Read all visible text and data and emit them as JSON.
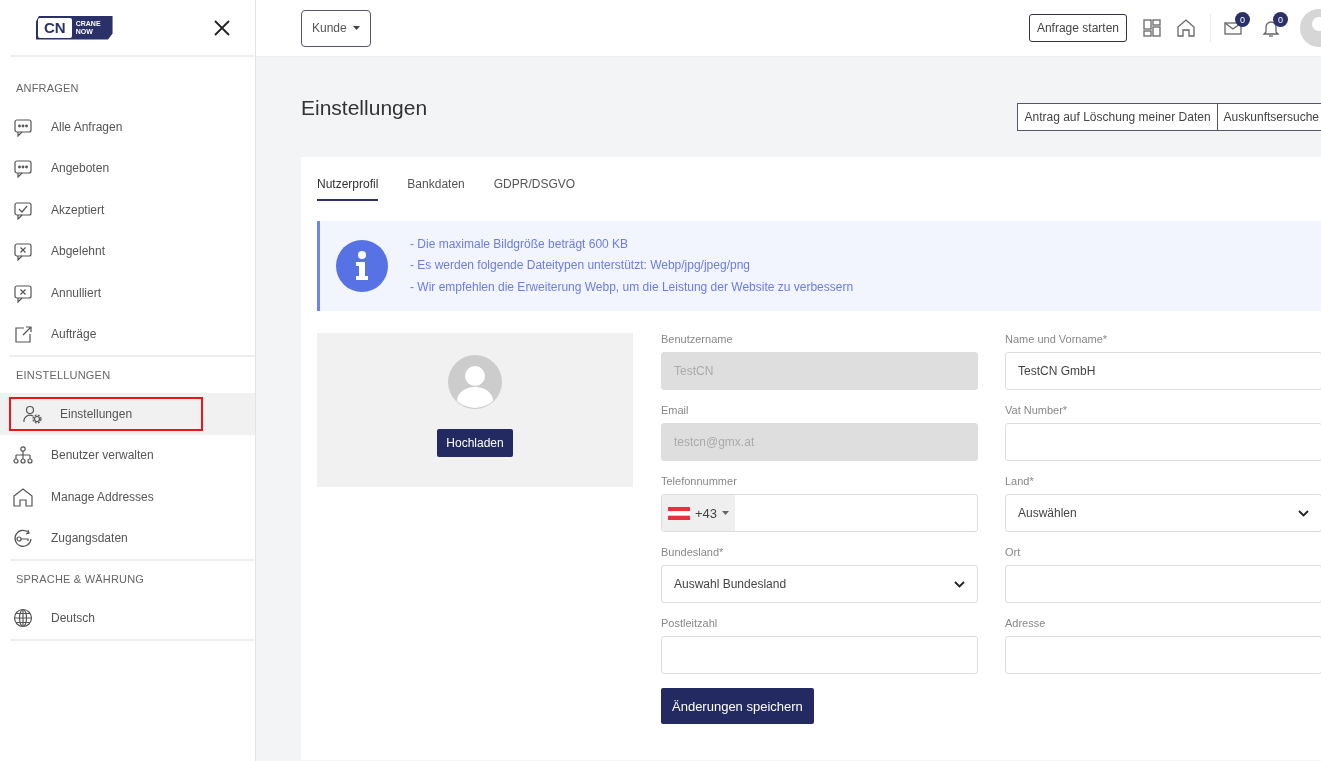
{
  "logo": {
    "mark": "CN",
    "word_top": "CRANE",
    "word_bottom": "NOW"
  },
  "sidebar": {
    "sections": [
      {
        "title": "ANFRAGEN",
        "items": [
          {
            "label": "Alle Anfragen",
            "selected": false,
            "highlighted": false
          },
          {
            "label": "Angeboten",
            "selected": false,
            "highlighted": false
          },
          {
            "label": "Akzeptiert",
            "selected": false,
            "highlighted": false
          },
          {
            "label": "Abgelehnt",
            "selected": false,
            "highlighted": false
          },
          {
            "label": "Annulliert",
            "selected": false,
            "highlighted": false
          },
          {
            "label": "Aufträge",
            "selected": false,
            "highlighted": false
          }
        ]
      },
      {
        "title": "EINSTELLUNGEN",
        "items": [
          {
            "label": "Einstellungen",
            "selected": true,
            "highlighted": true
          },
          {
            "label": "Benutzer verwalten",
            "selected": false,
            "highlighted": false
          },
          {
            "label": "Manage Addresses",
            "selected": false,
            "highlighted": false
          },
          {
            "label": "Zugangsdaten",
            "selected": false,
            "highlighted": false
          }
        ]
      },
      {
        "title": "SPRACHE & WÄHRUNG",
        "items": [
          {
            "label": "Deutsch",
            "selected": false,
            "highlighted": false
          }
        ]
      }
    ]
  },
  "topbar": {
    "role_dropdown": "Kunde",
    "start_button": "Anfrage starten",
    "messages_count": "0",
    "notifications_count": "0"
  },
  "page": {
    "title": "Einstellungen",
    "actions": [
      "Antrag auf Löschung meiner Daten",
      "Auskunftsersuche"
    ]
  },
  "tabs": [
    {
      "label": "Nutzerprofil",
      "selected": true
    },
    {
      "label": "Bankdaten",
      "selected": false
    },
    {
      "label": "GDPR/DSGVO",
      "selected": false
    }
  ],
  "info": [
    "- Die maximale Bildgröße beträgt 600 KB",
    "- Es werden folgende Dateitypen unterstützt: Webp/jpg/jpeg/png",
    "- Wir empfehlen die Erweiterung Webp, um die Leistung der Website zu verbessern"
  ],
  "avatar": {
    "upload_button": "Hochladen"
  },
  "fields": [
    {
      "label": "Benutzername",
      "kind": "text",
      "value": "TestCN",
      "disabled": true
    },
    {
      "label": "Name und Vorname*",
      "kind": "text",
      "value": "TestCN GmbH",
      "disabled": false
    },
    {
      "label": "Email",
      "kind": "text",
      "value": "testcn@gmx.at",
      "disabled": true
    },
    {
      "label": "Vat Number*",
      "kind": "text",
      "disabled": false
    },
    {
      "label": "Telefonnummer",
      "kind": "phone",
      "prefix": "+43",
      "disabled": false
    },
    {
      "label": "Land*",
      "kind": "select",
      "value": "Auswählen",
      "disabled": false
    },
    {
      "label": "Bundesland*",
      "kind": "select",
      "value": "Auswahl Bundesland",
      "disabled": false
    },
    {
      "label": "Ort",
      "kind": "text",
      "disabled": false
    },
    {
      "label": "Postleitzahl",
      "kind": "text",
      "disabled": false
    },
    {
      "label": "Adresse",
      "kind": "text",
      "disabled": false
    }
  ],
  "save_button": "Änderungen speichern"
}
